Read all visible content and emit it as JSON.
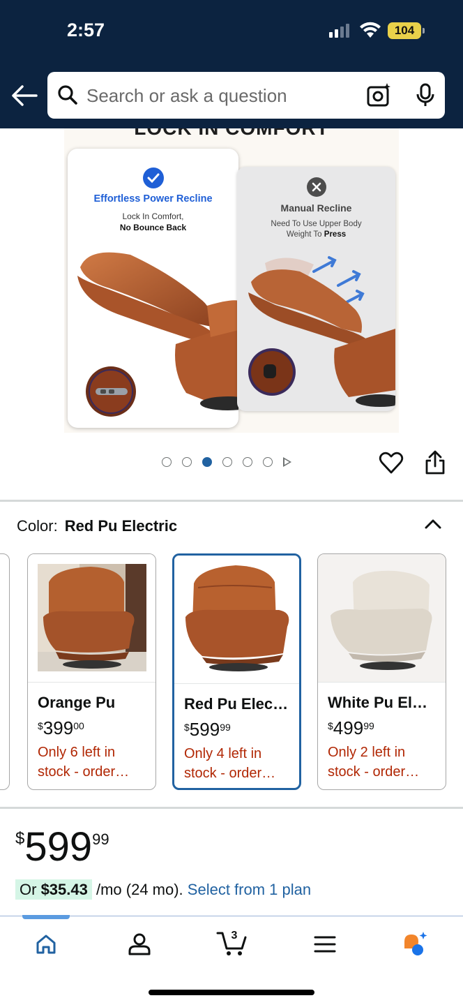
{
  "status_bar": {
    "time": "2:57",
    "battery": "104"
  },
  "search": {
    "placeholder": "Search or ask a question"
  },
  "hero": {
    "headline": "LOCK IN COMFORT",
    "left_card": {
      "title": "Effortless Power Recline",
      "line1": "Lock In Comfort,",
      "line2": "No Bounce Back"
    },
    "right_card": {
      "title": "Manual Recline",
      "line1": "Need To Use Upper Body",
      "line2_prefix": "Weight To ",
      "line2_bold": "Press"
    }
  },
  "carousel": {
    "total": 6,
    "active_index": 2
  },
  "color": {
    "label": "Color:",
    "value": "Red Pu Electric"
  },
  "swatches": [
    {
      "name": "Orange Pu",
      "currency": "$",
      "whole": "399",
      "fraction": "00",
      "stock": "Only 6 left in stock - order…",
      "selected": false
    },
    {
      "name": "Red Pu Elec…",
      "currency": "$",
      "whole": "599",
      "fraction": "99",
      "stock": "Only 4 left in stock - order…",
      "selected": true
    },
    {
      "name": "White Pu El…",
      "currency": "$",
      "whole": "499",
      "fraction": "99",
      "stock": "Only 2 left in stock - order…",
      "selected": false
    }
  ],
  "price": {
    "currency": "$",
    "whole": "599",
    "fraction": "99"
  },
  "installment": {
    "prefix": "Or ",
    "amount": "$35.43",
    "middle": " /mo (24 mo). ",
    "link": "Select from 1 plan"
  },
  "nav": {
    "cart_count": "3",
    "items": [
      "home-icon",
      "account-icon",
      "cart-icon",
      "menu-icon",
      "rufus-icon"
    ]
  },
  "colors": {
    "header": "#0c2340",
    "link": "#2162a1",
    "stock": "#b12704",
    "selected": "#2162a1"
  }
}
